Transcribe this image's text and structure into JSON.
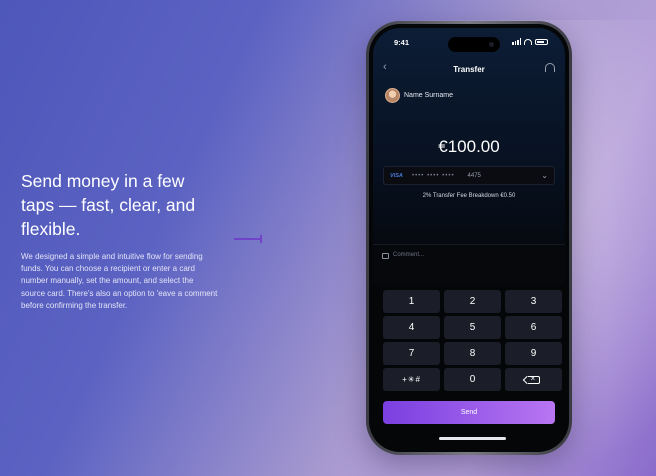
{
  "intro": {
    "heading": "Send money in a few taps — fast, clear, and flexible.",
    "description": "We designed a simple and intuitive flow for sending funds. You can choose a recipient or enter a card number manually, set the amount, and select the source card. There's also an option to 'eave a comment before confirming the transfer."
  },
  "status_bar": {
    "time": "9:41"
  },
  "screen": {
    "title": "Transfer",
    "recipient_name": "Name Surname",
    "amount": "€100.00",
    "card": {
      "brand": "VISA",
      "masked": "•••• •••• ••••",
      "last4": "4475"
    },
    "fee_text": "2% Transfer Fee Breakdown €0.50",
    "comment_placeholder": "Comment...",
    "keys": [
      "1",
      "2",
      "3",
      "4",
      "5",
      "6",
      "7",
      "8",
      "9",
      "+✳#",
      "0"
    ],
    "send_label": "Send"
  },
  "colors": {
    "accent": "#8a4ef0",
    "background_start": "#4e57ba",
    "background_end": "#b49fd8"
  }
}
